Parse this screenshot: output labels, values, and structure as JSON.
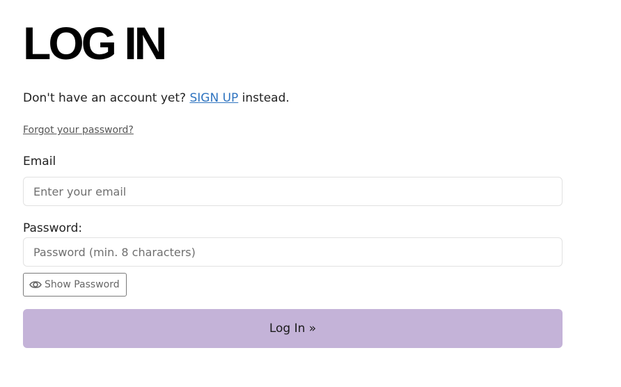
{
  "heading": {
    "title": "LOG IN"
  },
  "signup": {
    "prefix": "Don't have an account yet?",
    "link_label": "SIGN UP",
    "suffix": "instead."
  },
  "forgot": {
    "label": "Forgot your password?"
  },
  "email": {
    "label": "Email",
    "placeholder": "Enter your email",
    "value": ""
  },
  "password": {
    "label": "Password:",
    "placeholder": "Password (min. 8 characters)",
    "value": ""
  },
  "show_password": {
    "label": "Show Password",
    "icon": "eye-icon"
  },
  "login_button": {
    "label": "Log In »"
  },
  "colors": {
    "link": "#2f74c0",
    "button_bg": "#c4b3d8",
    "input_border": "#e1e1e1"
  }
}
